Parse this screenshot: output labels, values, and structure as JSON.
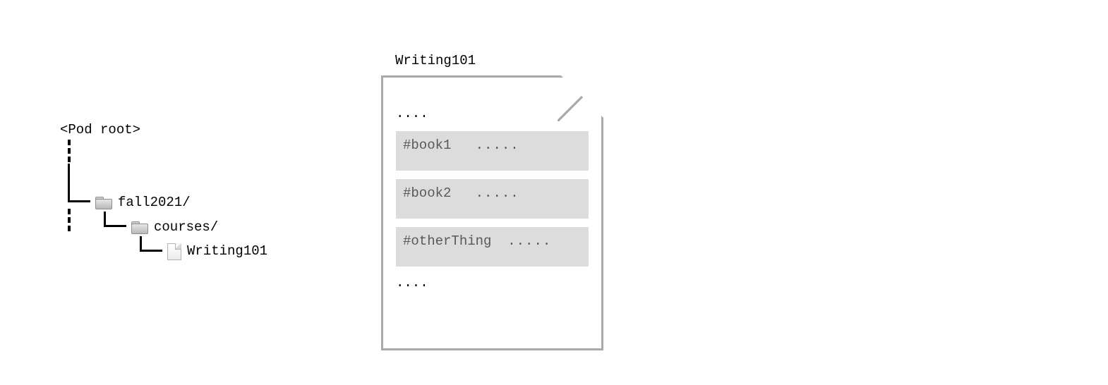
{
  "tree": {
    "root_label": "<Pod root>",
    "items": {
      "fall2021": "fall2021/",
      "courses": "courses/",
      "writing101": "Writing101"
    }
  },
  "document": {
    "title": "Writing101",
    "leading_ellipsis": "....",
    "trailing_ellipsis": "....",
    "blocks": [
      {
        "fragment": "#book1",
        "dots": "....."
      },
      {
        "fragment": "#book2",
        "dots": "....."
      },
      {
        "fragment": "#otherThing",
        "dots": "....."
      }
    ]
  }
}
